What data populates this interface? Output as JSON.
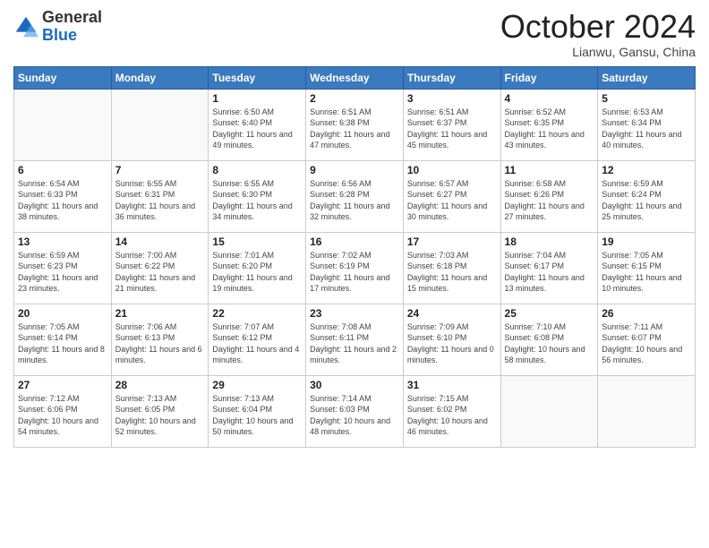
{
  "header": {
    "logo": {
      "line1": "General",
      "line2": "Blue"
    },
    "title": "October 2024",
    "location": "Lianwu, Gansu, China"
  },
  "days_of_week": [
    "Sunday",
    "Monday",
    "Tuesday",
    "Wednesday",
    "Thursday",
    "Friday",
    "Saturday"
  ],
  "weeks": [
    [
      {
        "day": "",
        "info": ""
      },
      {
        "day": "",
        "info": ""
      },
      {
        "day": "1",
        "info": "Sunrise: 6:50 AM\nSunset: 6:40 PM\nDaylight: 11 hours and 49 minutes."
      },
      {
        "day": "2",
        "info": "Sunrise: 6:51 AM\nSunset: 6:38 PM\nDaylight: 11 hours and 47 minutes."
      },
      {
        "day": "3",
        "info": "Sunrise: 6:51 AM\nSunset: 6:37 PM\nDaylight: 11 hours and 45 minutes."
      },
      {
        "day": "4",
        "info": "Sunrise: 6:52 AM\nSunset: 6:35 PM\nDaylight: 11 hours and 43 minutes."
      },
      {
        "day": "5",
        "info": "Sunrise: 6:53 AM\nSunset: 6:34 PM\nDaylight: 11 hours and 40 minutes."
      }
    ],
    [
      {
        "day": "6",
        "info": "Sunrise: 6:54 AM\nSunset: 6:33 PM\nDaylight: 11 hours and 38 minutes."
      },
      {
        "day": "7",
        "info": "Sunrise: 6:55 AM\nSunset: 6:31 PM\nDaylight: 11 hours and 36 minutes."
      },
      {
        "day": "8",
        "info": "Sunrise: 6:55 AM\nSunset: 6:30 PM\nDaylight: 11 hours and 34 minutes."
      },
      {
        "day": "9",
        "info": "Sunrise: 6:56 AM\nSunset: 6:28 PM\nDaylight: 11 hours and 32 minutes."
      },
      {
        "day": "10",
        "info": "Sunrise: 6:57 AM\nSunset: 6:27 PM\nDaylight: 11 hours and 30 minutes."
      },
      {
        "day": "11",
        "info": "Sunrise: 6:58 AM\nSunset: 6:26 PM\nDaylight: 11 hours and 27 minutes."
      },
      {
        "day": "12",
        "info": "Sunrise: 6:59 AM\nSunset: 6:24 PM\nDaylight: 11 hours and 25 minutes."
      }
    ],
    [
      {
        "day": "13",
        "info": "Sunrise: 6:59 AM\nSunset: 6:23 PM\nDaylight: 11 hours and 23 minutes."
      },
      {
        "day": "14",
        "info": "Sunrise: 7:00 AM\nSunset: 6:22 PM\nDaylight: 11 hours and 21 minutes."
      },
      {
        "day": "15",
        "info": "Sunrise: 7:01 AM\nSunset: 6:20 PM\nDaylight: 11 hours and 19 minutes."
      },
      {
        "day": "16",
        "info": "Sunrise: 7:02 AM\nSunset: 6:19 PM\nDaylight: 11 hours and 17 minutes."
      },
      {
        "day": "17",
        "info": "Sunrise: 7:03 AM\nSunset: 6:18 PM\nDaylight: 11 hours and 15 minutes."
      },
      {
        "day": "18",
        "info": "Sunrise: 7:04 AM\nSunset: 6:17 PM\nDaylight: 11 hours and 13 minutes."
      },
      {
        "day": "19",
        "info": "Sunrise: 7:05 AM\nSunset: 6:15 PM\nDaylight: 11 hours and 10 minutes."
      }
    ],
    [
      {
        "day": "20",
        "info": "Sunrise: 7:05 AM\nSunset: 6:14 PM\nDaylight: 11 hours and 8 minutes."
      },
      {
        "day": "21",
        "info": "Sunrise: 7:06 AM\nSunset: 6:13 PM\nDaylight: 11 hours and 6 minutes."
      },
      {
        "day": "22",
        "info": "Sunrise: 7:07 AM\nSunset: 6:12 PM\nDaylight: 11 hours and 4 minutes."
      },
      {
        "day": "23",
        "info": "Sunrise: 7:08 AM\nSunset: 6:11 PM\nDaylight: 11 hours and 2 minutes."
      },
      {
        "day": "24",
        "info": "Sunrise: 7:09 AM\nSunset: 6:10 PM\nDaylight: 11 hours and 0 minutes."
      },
      {
        "day": "25",
        "info": "Sunrise: 7:10 AM\nSunset: 6:08 PM\nDaylight: 10 hours and 58 minutes."
      },
      {
        "day": "26",
        "info": "Sunrise: 7:11 AM\nSunset: 6:07 PM\nDaylight: 10 hours and 56 minutes."
      }
    ],
    [
      {
        "day": "27",
        "info": "Sunrise: 7:12 AM\nSunset: 6:06 PM\nDaylight: 10 hours and 54 minutes."
      },
      {
        "day": "28",
        "info": "Sunrise: 7:13 AM\nSunset: 6:05 PM\nDaylight: 10 hours and 52 minutes."
      },
      {
        "day": "29",
        "info": "Sunrise: 7:13 AM\nSunset: 6:04 PM\nDaylight: 10 hours and 50 minutes."
      },
      {
        "day": "30",
        "info": "Sunrise: 7:14 AM\nSunset: 6:03 PM\nDaylight: 10 hours and 48 minutes."
      },
      {
        "day": "31",
        "info": "Sunrise: 7:15 AM\nSunset: 6:02 PM\nDaylight: 10 hours and 46 minutes."
      },
      {
        "day": "",
        "info": ""
      },
      {
        "day": "",
        "info": ""
      }
    ]
  ]
}
